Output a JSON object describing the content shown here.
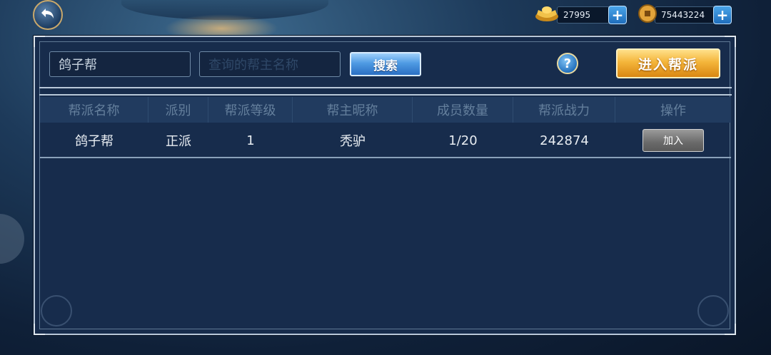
{
  "currency": {
    "ingot": {
      "icon": "gold-ingot-icon",
      "value": "27995"
    },
    "coin": {
      "icon": "copper-coin-icon",
      "value": "75443224"
    }
  },
  "search": {
    "guild_name_value": "鸽子帮",
    "leader_placeholder": "查询的帮主名称",
    "button_label": "搜索"
  },
  "help_label": "?",
  "enter_guild_label": "进入帮派",
  "table": {
    "headers": [
      "帮派名称",
      "派别",
      "帮派等级",
      "帮主昵称",
      "成员数量",
      "帮派战力",
      "操作"
    ],
    "rows": [
      [
        "鸽子帮",
        "正派",
        "1",
        "秃驴",
        "1/20",
        "242874",
        "加入"
      ]
    ]
  },
  "colors": {
    "panel": "#172c4c",
    "gold_button": "#f4b53a",
    "blue_button": "#4f9be3"
  }
}
